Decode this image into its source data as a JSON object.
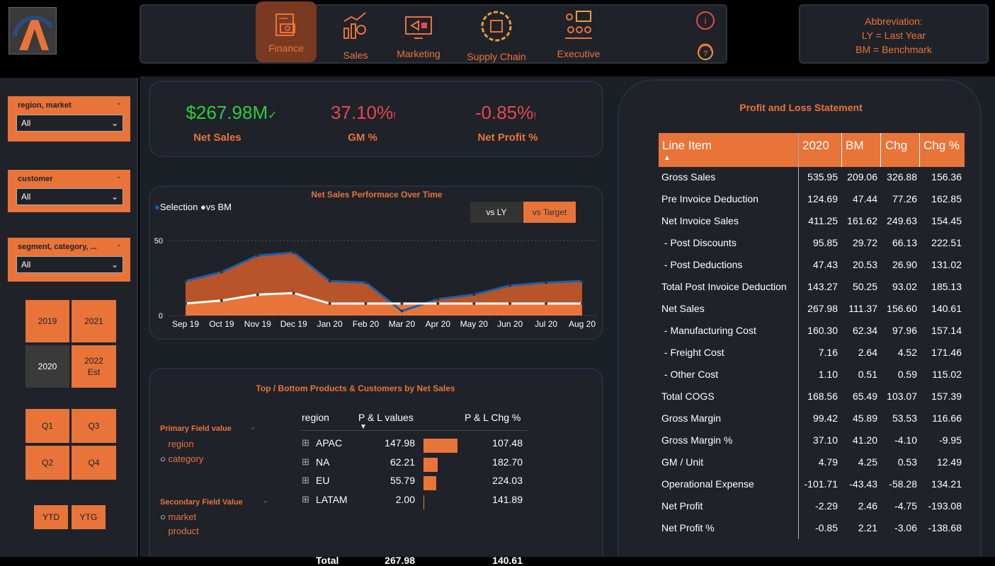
{
  "nav": {
    "items": [
      {
        "label": "Finance",
        "icon": "finance-icon"
      },
      {
        "label": "Sales",
        "icon": "sales-icon"
      },
      {
        "label": "Marketing",
        "icon": "marketing-icon"
      },
      {
        "label": "Supply Chain",
        "icon": "supply-chain-icon"
      },
      {
        "label": "Executive",
        "icon": "executive-icon"
      }
    ],
    "info_icon": "info-icon",
    "support_icon": "support-icon"
  },
  "abbreviation": {
    "title": "Abbreviation:",
    "ly": "LY = Last Year",
    "bm": "BM = Benchmark"
  },
  "filters": {
    "region": {
      "label": "region, market",
      "value": "All"
    },
    "customer": {
      "label": "customer",
      "value": "All"
    },
    "segment": {
      "label": "segment, category, ...",
      "value": "All"
    }
  },
  "years": {
    "y2019": "2019",
    "y2021": "2021",
    "y2020": "2020",
    "y2022": "2022",
    "y2022b": "Est"
  },
  "quarters": {
    "q1": "Q1",
    "q3": "Q3",
    "q2": "Q2",
    "q4": "Q4"
  },
  "periods": {
    "ytd": "YTD",
    "ytg": "YTG"
  },
  "kpis": [
    {
      "value": "$267.98M",
      "label": "Net Sales",
      "color": "#2ecc40",
      "mark": "✓"
    },
    {
      "value": "37.10%",
      "label": "GM %",
      "color": "#e8474f",
      "mark": "!"
    },
    {
      "value": "-0.85%",
      "label": "Net Profit %",
      "color": "#e8474f",
      "mark": "!"
    }
  ],
  "chart": {
    "title": "Net Sales Performace Over Time",
    "legend_selection": "Selection",
    "legend_bm": "vs BM",
    "toggle_ly": "vs LY",
    "toggle_target": "vs Target",
    "ytick_50": "50",
    "ytick_0": "0"
  },
  "chart_data": {
    "type": "area",
    "title": "Net Sales Performace Over Time",
    "categories": [
      "Sep 19",
      "Oct 19",
      "Nov 19",
      "Dec 19",
      "Jan 20",
      "Feb 20",
      "Mar 20",
      "Apr 20",
      "May 20",
      "Jun 20",
      "Jul 20",
      "Aug 20"
    ],
    "series": [
      {
        "name": "Selection",
        "values": [
          23,
          29,
          40,
          42,
          23,
          22,
          3,
          11,
          14,
          20,
          22,
          23
        ],
        "color": "#1f5fa8"
      },
      {
        "name": "vs BM",
        "values": [
          8,
          10,
          14,
          15,
          8,
          8,
          8,
          8,
          8,
          8,
          8,
          8
        ],
        "color": "#ffffff"
      }
    ],
    "ylim": [
      0,
      50
    ],
    "yticks": [
      0,
      50
    ]
  },
  "bottom_panel": {
    "title": "Top / Bottom Products & Customers by Net Sales",
    "primary_label": "Primary Field value",
    "primary_options": [
      "region",
      "category"
    ],
    "secondary_label": "Secondary Field Value",
    "secondary_options": [
      "market",
      "product"
    ],
    "columns": [
      "region",
      "P & L values",
      "P & L Chg %"
    ],
    "rows": [
      {
        "name": "APAC",
        "value": "147.98",
        "chg": "107.48",
        "bar": 1.0
      },
      {
        "name": "NA",
        "value": "62.21",
        "chg": "182.70",
        "bar": 0.42
      },
      {
        "name": "EU",
        "value": "55.79",
        "chg": "224.03",
        "bar": 0.38
      },
      {
        "name": "LATAM",
        "value": "2.00",
        "chg": "141.89",
        "bar": 0.02
      }
    ],
    "total": {
      "name": "Total",
      "value": "267.98",
      "chg": "140.61"
    }
  },
  "pl": {
    "title": "Profit and Loss Statement",
    "columns": [
      "Line Item",
      "2020",
      "BM",
      "Chg",
      "Chg %"
    ],
    "rows": [
      [
        "Gross Sales",
        "535.95",
        "209.06",
        "326.88",
        "156.36"
      ],
      [
        "Pre Invoice Deduction",
        "124.69",
        "47.44",
        "77.26",
        "162.85"
      ],
      [
        "Net Invoice Sales",
        "411.25",
        "161.62",
        "249.63",
        "154.45"
      ],
      [
        " - Post Discounts",
        "95.85",
        "29.72",
        "66.13",
        "222.51"
      ],
      [
        " - Post Deductions",
        "47.43",
        "20.53",
        "26.90",
        "131.02"
      ],
      [
        "Total Post Invoice Deduction",
        "143.27",
        "50.25",
        "93.02",
        "185.13"
      ],
      [
        "Net Sales",
        "267.98",
        "111.37",
        "156.60",
        "140.61"
      ],
      [
        " - Manufacturing Cost",
        "160.30",
        "62.34",
        "97.96",
        "157.14"
      ],
      [
        " - Freight Cost",
        "7.16",
        "2.64",
        "4.52",
        "171.46"
      ],
      [
        " - Other Cost",
        "1.10",
        "0.51",
        "0.59",
        "115.02"
      ],
      [
        "Total COGS",
        "168.56",
        "65.49",
        "103.07",
        "157.39"
      ],
      [
        "Gross Margin",
        "99.42",
        "45.89",
        "53.53",
        "116.66"
      ],
      [
        "Gross Margin %",
        "37.10",
        "41.20",
        "-4.10",
        "-9.95"
      ],
      [
        "GM / Unit",
        "4.79",
        "4.25",
        "0.53",
        "12.49"
      ],
      [
        "Operational Expense",
        "-101.71",
        "-43.43",
        "-58.28",
        "134.21"
      ],
      [
        "Net Profit",
        "-2.29",
        "2.46",
        "-4.75",
        "-193.08"
      ],
      [
        "Net Profit %",
        "-0.85",
        "2.21",
        "-3.06",
        "-138.68"
      ]
    ]
  }
}
